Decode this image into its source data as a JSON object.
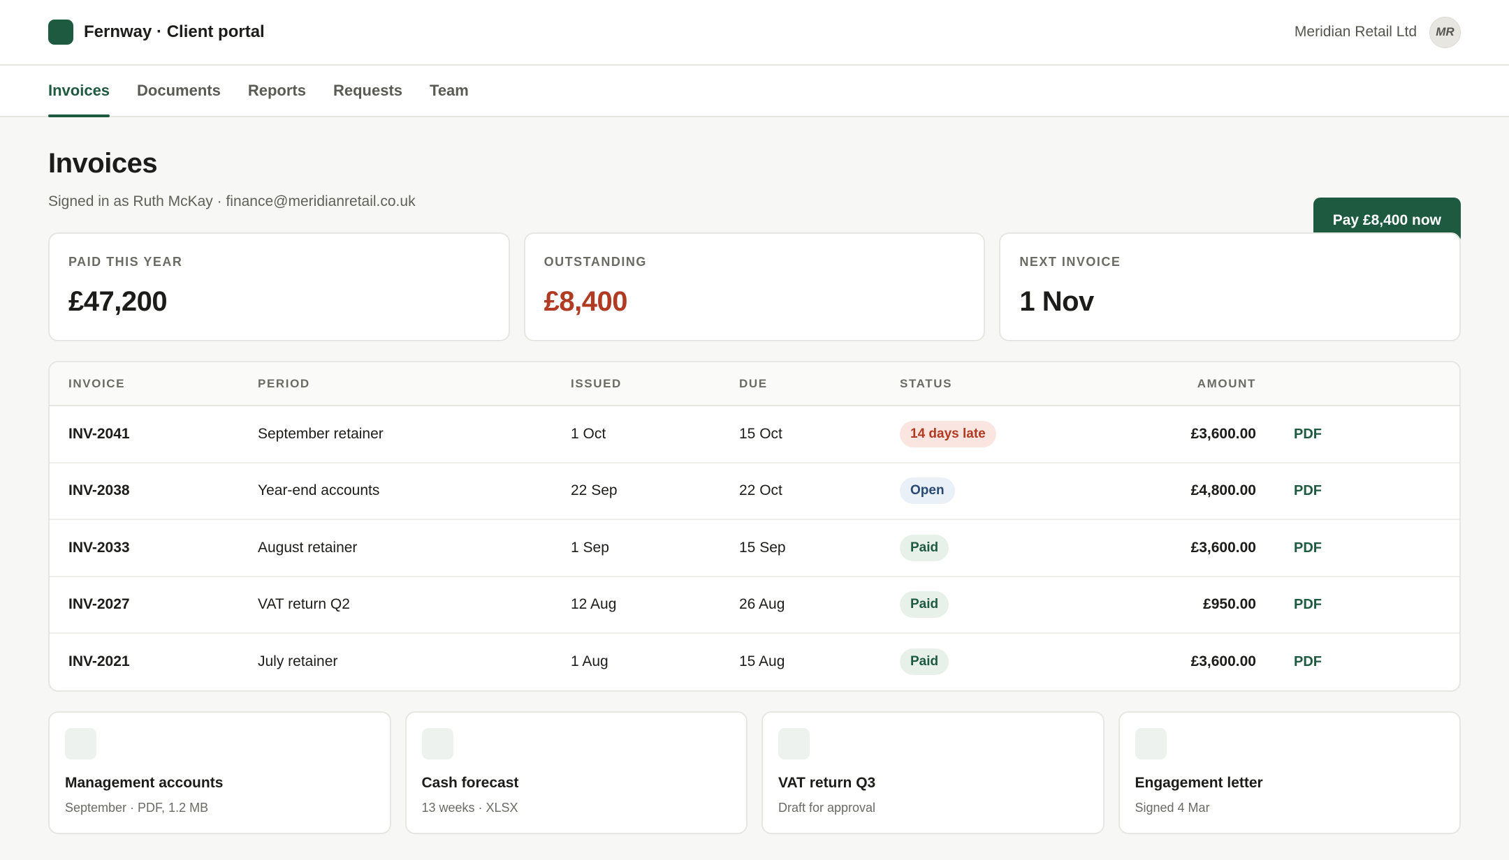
{
  "app": {
    "brand": "Fernway · Client portal",
    "account_name": "Meridian Retail Ltd",
    "avatar_initials": "MR"
  },
  "nav": {
    "tabs": [
      {
        "label": "Invoices",
        "active": true
      },
      {
        "label": "Documents",
        "active": false
      },
      {
        "label": "Reports",
        "active": false
      },
      {
        "label": "Requests",
        "active": false
      },
      {
        "label": "Team",
        "active": false
      }
    ]
  },
  "page": {
    "title": "Invoices",
    "subtitle": "Signed in as Ruth McKay · finance@meridianretail.co.uk",
    "pay_button": "Pay £8,400 now"
  },
  "stats": [
    {
      "label": "PAID THIS YEAR",
      "value": "£47,200"
    },
    {
      "label": "OUTSTANDING",
      "value": "£8,400"
    },
    {
      "label": "NEXT INVOICE",
      "value": "1 Nov"
    }
  ],
  "table": {
    "headers": {
      "invoice": "INVOICE",
      "period": "PERIOD",
      "issued": "ISSUED",
      "due": "DUE",
      "status": "STATUS",
      "amount": "AMOUNT"
    },
    "rows": [
      {
        "invoice": "INV-2041",
        "period": "September retainer",
        "issued": "1 Oct",
        "due": "15 Oct",
        "status": "14 days late",
        "amount": "£3,600.00",
        "pdf": "PDF"
      },
      {
        "invoice": "INV-2038",
        "period": "Year-end accounts",
        "issued": "22 Sep",
        "due": "22 Oct",
        "status": "Open",
        "amount": "£4,800.00",
        "pdf": "PDF"
      },
      {
        "invoice": "INV-2033",
        "period": "August retainer",
        "issued": "1 Sep",
        "due": "15 Sep",
        "status": "Paid",
        "amount": "£3,600.00",
        "pdf": "PDF"
      },
      {
        "invoice": "INV-2027",
        "period": "VAT return Q2",
        "issued": "12 Aug",
        "due": "26 Aug",
        "status": "Paid",
        "amount": "£950.00",
        "pdf": "PDF"
      },
      {
        "invoice": "INV-2021",
        "period": "July retainer",
        "issued": "1 Aug",
        "due": "15 Aug",
        "status": "Paid",
        "amount": "£3,600.00",
        "pdf": "PDF"
      }
    ]
  },
  "documents": [
    {
      "title": "Management accounts",
      "meta": "September · PDF, 1.2 MB"
    },
    {
      "title": "Cash forecast",
      "meta": "13 weeks · XLSX"
    },
    {
      "title": "VAT return Q3",
      "meta": "Draft for approval"
    },
    {
      "title": "Engagement letter",
      "meta": "Signed 4 Mar"
    }
  ],
  "colors": {
    "accent": "#1e5a40",
    "alert": "#b03a22",
    "open": "#284a72"
  }
}
